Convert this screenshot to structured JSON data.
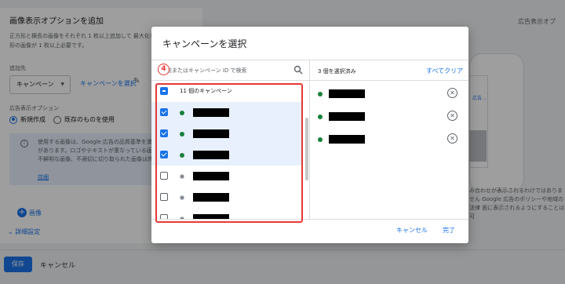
{
  "background": {
    "panel_title": "画像表示オプションを追加",
    "description": "正方形と横長の画像をそれぞれ 1 枚以上追加して 最大化しましょう。正方形の画像が 1 枚以上必要です。",
    "add_to_label": "追加先",
    "add_to_select": "キャンペーン",
    "campaign_link": "キャンペーンを選択",
    "ad_option_label": "広告表示オプション",
    "radio_new": "新規作成",
    "radio_existing": "既存のものを使用",
    "info_text": "使用する画像は、Google 広告の品質基準を満たしている必要があります。ロゴやテキストが重なっている画像、GIF 画像、不鮮明な画像、不適切に切り取られた画像は許可されません。",
    "info_link": "詳細",
    "add_image": "画像",
    "details": "詳細設定",
    "save_button": "保存",
    "cancel_button": "キャンセル",
    "preview_title": "広告表示オプ",
    "preview_card_text": "広告 ..",
    "preview_note": "み合わせが表示されるわけではありません Google 広告のポリシーや地域の法律 面に表示されるようにすることは可"
  },
  "modal": {
    "title": "キャンペーンを選択",
    "search_placeholder": "名前またはキャンペーン ID で検索",
    "select_all_label": "11 個のキャンペーン",
    "list_rows": [
      {
        "checked": true,
        "status": "green"
      },
      {
        "checked": true,
        "status": "green"
      },
      {
        "checked": true,
        "status": "green"
      },
      {
        "checked": false,
        "status": "grey"
      },
      {
        "checked": false,
        "status": "grey"
      },
      {
        "checked": false,
        "status": "grey"
      }
    ],
    "selected_count": "3 個を選択済み",
    "clear_all": "すべてクリア",
    "selected_rows": [
      {
        "status": "green"
      },
      {
        "status": "green"
      },
      {
        "status": "green"
      }
    ],
    "cancel": "キャンセル",
    "done": "完了"
  },
  "annotation": {
    "number": "4"
  },
  "colors": {
    "accent": "#1a73e8",
    "active": "#188038",
    "annotation": "#e53935"
  }
}
